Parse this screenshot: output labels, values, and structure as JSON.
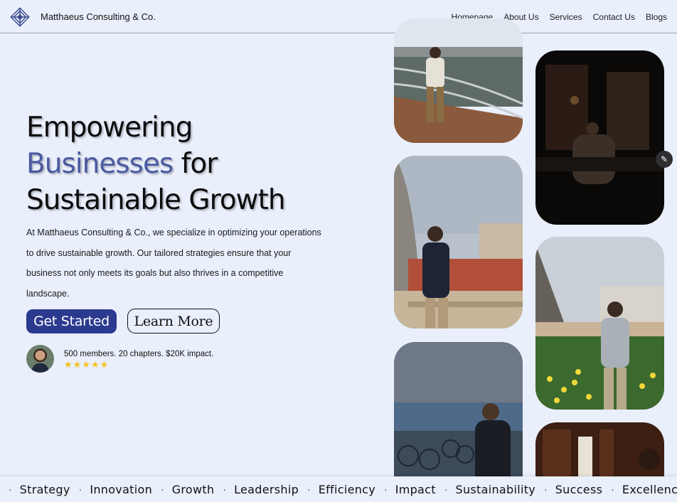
{
  "brand": {
    "name": "Matthaeus Consulting & Co.",
    "logo_icon": "diamond-logo-icon"
  },
  "nav": {
    "links": [
      "Homepage",
      "About Us",
      "Services",
      "Contact Us",
      "Blogs"
    ]
  },
  "hero": {
    "title_line1": "Empowering",
    "title_accent": "Businesses",
    "title_after_accent": " for",
    "title_line3": "Sustainable Growth",
    "body": "At Matthaeus Consulting & Co., we specialize in optimizing your operations to drive sustainable growth. Our tailored strategies ensure that your business not only meets its goals but also thrives in a competitive landscape.",
    "primary_cta": "Get Started",
    "secondary_cta": "Learn More",
    "social_proof": "500 members. 20 chapters. $20K impact.",
    "rating_stars": "★★★★★"
  },
  "ticker": {
    "items": [
      "Strategy",
      "Innovation",
      "Growth",
      "Leadership",
      "Efficiency",
      "Impact",
      "Sustainability",
      "Success",
      "Excellence"
    ],
    "separator": "·"
  },
  "colors": {
    "background": "#e9effb",
    "accent": "#4b5aa0",
    "primary_button": "#2b3a8f",
    "star": "#f4c21b"
  }
}
